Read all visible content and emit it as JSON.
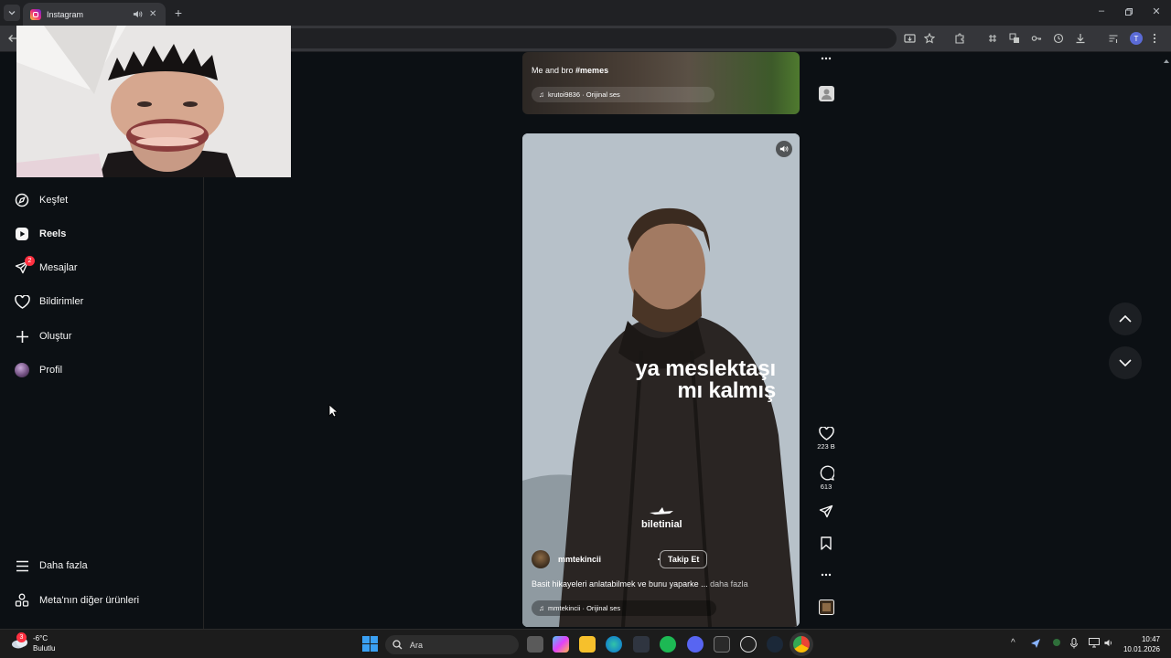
{
  "browser": {
    "tab_title": "Instagram",
    "new_tab": "+",
    "avatar_initial": "T"
  },
  "sidebar": {
    "items": [
      {
        "label": "Keşfet",
        "icon": "compass-icon"
      },
      {
        "label": "Reels",
        "icon": "reels-icon",
        "active": true
      },
      {
        "label": "Mesajlar",
        "icon": "messages-icon",
        "badge": "2"
      },
      {
        "label": "Bildirimler",
        "icon": "heart-icon"
      },
      {
        "label": "Oluştur",
        "icon": "plus-icon"
      },
      {
        "label": "Profil",
        "icon": "avatar"
      }
    ],
    "bottom": [
      {
        "label": "Daha fazla",
        "icon": "menu-icon"
      },
      {
        "label": "Meta'nın diğer ürünleri",
        "icon": "grid-icon"
      }
    ]
  },
  "reel_prev": {
    "caption": "Me and bro",
    "hashtag": "#memes",
    "audio": "krutoi9836 · Orijinal ses"
  },
  "reel": {
    "overlay_line1": "ya meslektaşı",
    "overlay_line2": "mı kalmış",
    "brand": "biletinial",
    "author": "mmtekincii",
    "follow": "Takip Et",
    "caption": "Basit hikayeleri anlatabilmek ve bunu yaparke ...",
    "more": "daha fazla",
    "audio": "mmtekincii · Orijinal ses",
    "likes": "223 B",
    "comments": "613"
  },
  "taskbar": {
    "weather_temp": "-6°C",
    "weather_desc": "Bulutlu",
    "weather_badge": "3",
    "search": "Ara",
    "time": "10:47",
    "date": "10.01.2026"
  }
}
